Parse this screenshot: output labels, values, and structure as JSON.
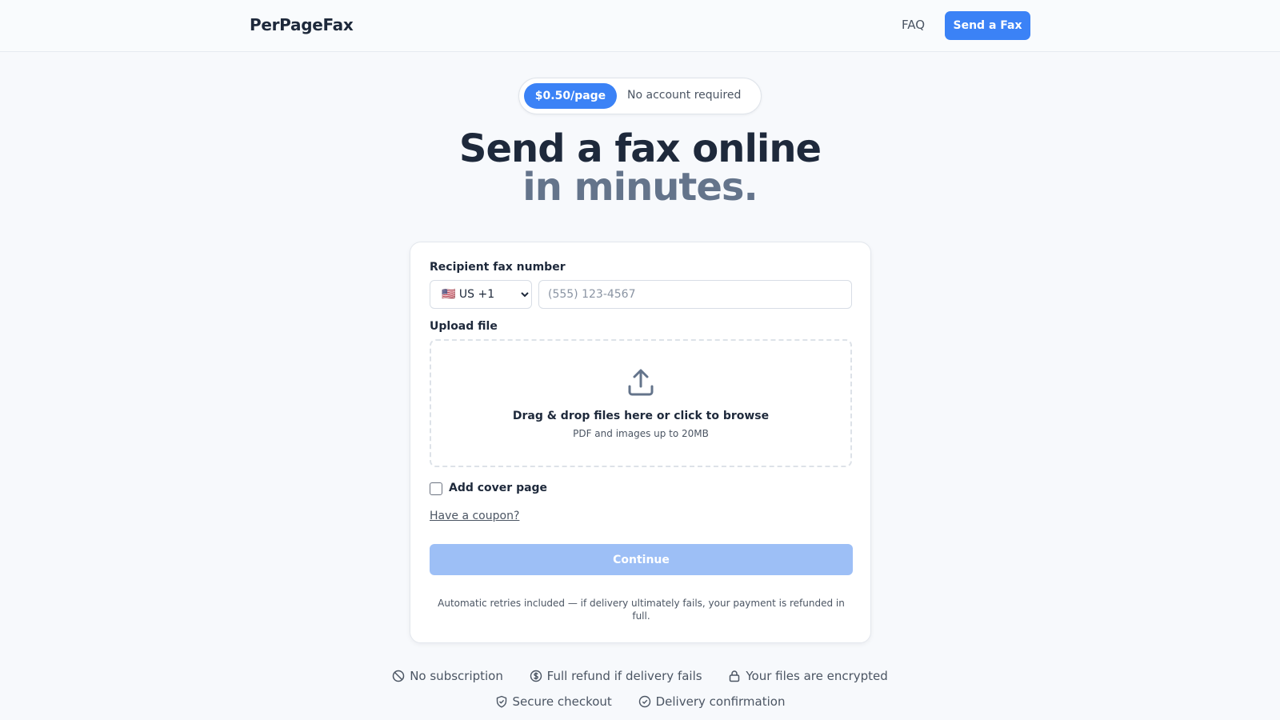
{
  "header": {
    "logo": "PerPageFax",
    "nav_faq": "FAQ",
    "nav_send": "Send a Fax"
  },
  "pill": {
    "price": "$0.50/page",
    "note": "No account required"
  },
  "hero": {
    "line1": "Send a fax online",
    "line2": "in minutes."
  },
  "form": {
    "recipient_label": "Recipient fax number",
    "country_selected": "🇺🇸 US +1",
    "phone_placeholder": "(555) 123-4567",
    "upload_label": "Upload file",
    "upload_icon": "upload-icon",
    "dropzone_main": "Drag & drop files here or click to browse",
    "dropzone_sub": "PDF and images up to 20MB",
    "cover_label": "Add cover page",
    "coupon_link": "Have a coupon?",
    "continue_label": "Continue",
    "footnote": "Automatic retries included — if delivery ultimately fails, your payment is refunded in full."
  },
  "trust": {
    "row1": [
      {
        "icon": "ban-icon",
        "label": "No subscription"
      },
      {
        "icon": "dollar-circle-icon",
        "label": "Full refund if delivery fails"
      },
      {
        "icon": "lock-icon",
        "label": "Your files are encrypted"
      }
    ],
    "row2": [
      {
        "icon": "shield-check-icon",
        "label": "Secure checkout"
      },
      {
        "icon": "check-circle-icon",
        "label": "Delivery confirmation"
      }
    ]
  },
  "colors": {
    "accent": "#3b82f6",
    "accent_disabled": "#9dbff6",
    "text_dark": "#1e293b",
    "text_muted": "#64748b",
    "background": "#f7f9fc"
  }
}
